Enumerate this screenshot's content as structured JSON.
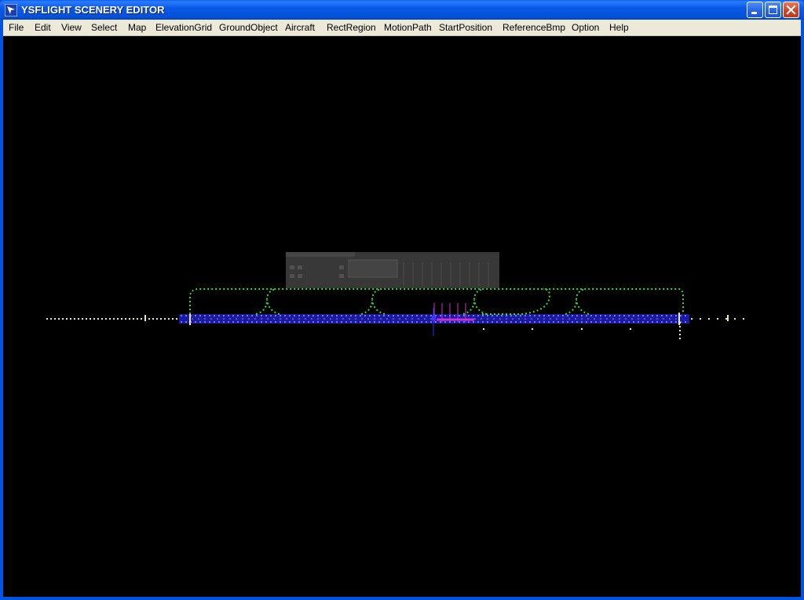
{
  "window": {
    "title": "YSFLIGHT SCENERY EDITOR",
    "controls": [
      "minimize-icon",
      "maximize-icon",
      "close-icon"
    ]
  },
  "menubar": {
    "items": [
      {
        "label": "File"
      },
      {
        "label": "Edit"
      },
      {
        "label": "View"
      },
      {
        "label": "Select"
      },
      {
        "label": "Map"
      },
      {
        "label": "ElevationGrid"
      },
      {
        "label": "GroundObject"
      },
      {
        "label": "Aircraft"
      },
      {
        "label": "RectRegion"
      },
      {
        "label": "MotionPath"
      },
      {
        "label": "StartPosition"
      },
      {
        "label": "ReferenceBmp"
      },
      {
        "label": "Option"
      },
      {
        "label": "Help"
      }
    ]
  },
  "viewport": {
    "background": "#000000",
    "colors": {
      "taxiway": "#33dd33",
      "runway": "#2020c0",
      "runway_lights": "#e8e8c0",
      "aircraft": "#cc33cc",
      "building": "#3a3a3a"
    }
  }
}
